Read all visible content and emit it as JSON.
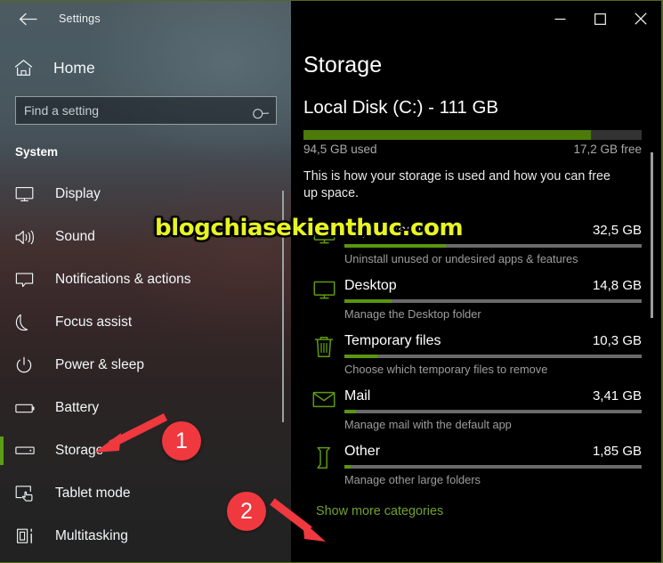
{
  "window": {
    "titlebar": {
      "back_icon": "back-arrow-icon",
      "title": "Settings",
      "minimize_label": "—",
      "maximize_label": "□",
      "close_label": "✕"
    }
  },
  "sidebar": {
    "home": {
      "icon": "home-icon",
      "label": "Home"
    },
    "search": {
      "placeholder": "Find a setting",
      "value": "",
      "icon": "search-icon"
    },
    "section_header": "System",
    "items": [
      {
        "label": "Display",
        "icon": "monitor-icon",
        "selected": false
      },
      {
        "label": "Sound",
        "icon": "speaker-icon",
        "selected": false
      },
      {
        "label": "Notifications & actions",
        "icon": "notification-icon",
        "selected": false
      },
      {
        "label": "Focus assist",
        "icon": "moon-icon",
        "selected": false
      },
      {
        "label": "Power & sleep",
        "icon": "power-icon",
        "selected": false
      },
      {
        "label": "Battery",
        "icon": "battery-icon",
        "selected": false
      },
      {
        "label": "Storage",
        "icon": "storage-drive-icon",
        "selected": true
      },
      {
        "label": "Tablet mode",
        "icon": "tablet-hand-icon",
        "selected": false
      },
      {
        "label": "Multitasking",
        "icon": "multitasking-icon",
        "selected": false
      }
    ]
  },
  "main": {
    "page_title": "Storage",
    "disk": {
      "title": "Local Disk (C:) - 111 GB",
      "used_label": "94,5 GB used",
      "free_label": "17,2 GB free",
      "used_percent": 85
    },
    "description": "This is how your storage is used and how you can free up space.",
    "categories": [
      {
        "name": "Apps & features",
        "size": "32,5 GB",
        "percent": 34,
        "sub": "Uninstall unused or undesired apps & features",
        "icon": "monitor-icon"
      },
      {
        "name": "Desktop",
        "size": "14,8 GB",
        "percent": 16,
        "sub": "Manage the Desktop folder",
        "icon": "monitor-icon"
      },
      {
        "name": "Temporary files",
        "size": "10,3 GB",
        "percent": 11,
        "sub": "Choose which temporary files to remove",
        "icon": "trash-icon"
      },
      {
        "name": "Mail",
        "size": "3,41 GB",
        "percent": 4,
        "sub": "Manage mail with the default app",
        "icon": "envelope-icon"
      },
      {
        "name": "Other",
        "size": "1,85 GB",
        "percent": 2,
        "sub": "Manage other large folders",
        "icon": "page-fold-icon"
      }
    ],
    "show_more_label": "Show more categories"
  },
  "watermark": {
    "text": "blogchiasekienthuc.com",
    "color": "#e8f521"
  },
  "annotations": {
    "badges": [
      {
        "label": "1",
        "color": "#f0383f"
      },
      {
        "label": "2",
        "color": "#f0383f"
      }
    ],
    "arrow_color": "#f0383f"
  },
  "colors": {
    "accent_green": "#5a9e16",
    "bar_green": "#4c7a0b",
    "link_green": "#6fa12c",
    "annotation_red": "#f0383f"
  }
}
